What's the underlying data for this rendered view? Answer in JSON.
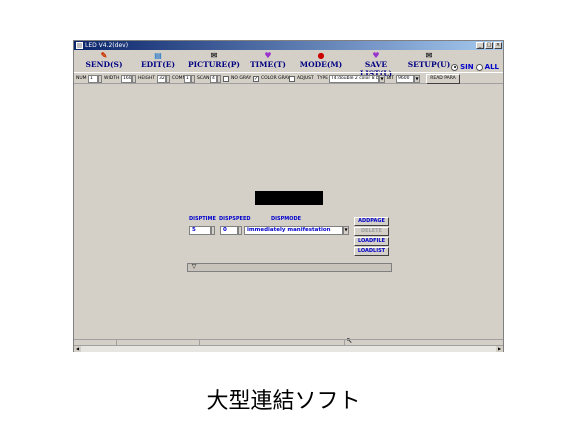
{
  "window": {
    "title": "LED V4.2(dev)",
    "controls": [
      "_",
      "□",
      "×"
    ]
  },
  "menu": [
    {
      "label": "SEND(S)",
      "icon": "send-icon",
      "glyph": "✎"
    },
    {
      "label": "EDIT(E)",
      "icon": "edit-icon",
      "glyph": "▤"
    },
    {
      "label": "PICTURE(P)",
      "icon": "picture-icon",
      "glyph": "✉"
    },
    {
      "label": "TIME(T)",
      "icon": "time-icon",
      "glyph": "♥"
    },
    {
      "label": "MODE(M)",
      "icon": "mode-icon",
      "glyph": "●"
    },
    {
      "label": "SAVE LIST(L)",
      "icon": "save-list-icon",
      "glyph": "♥"
    },
    {
      "label": "SETUP(U)",
      "icon": "setup-icon",
      "glyph": "✉"
    }
  ],
  "mode_radio": {
    "single": "SIN",
    "all": "ALL",
    "selected": "single"
  },
  "toolbar": {
    "num_label": "NUM",
    "num_value": "1",
    "width_label": "WIDTH",
    "width_value": "160",
    "height_label": "HEIGHT",
    "height_value": "32",
    "comm_label": "COMM",
    "comm_value": "1",
    "scan_label": "SCAN",
    "scan_value": "4",
    "no_gray_label": "NO GRAY",
    "no_gray_checked": false,
    "color_gray_label": "COLOR GRAY",
    "color_gray_checked": true,
    "adjust_label": "ADJUST",
    "adjust_checked": false,
    "type_label": "TYPE",
    "type_value": "T4:double 2 color 8 bit",
    "bit_label": "BIT",
    "bit_value": "9600",
    "read_para_label": "READ PARA"
  },
  "panel": {
    "disptime_label": "DISPTIME",
    "disptime_value": "5",
    "dispspeed_label": "DISPSPEED",
    "dispspeed_value": "0",
    "dispmode_label": "DISPMODE",
    "dispmode_value": "immediately manifestation",
    "buttons": {
      "addpage": "ADDPAGE",
      "delete": "DELETE",
      "loadfile": "LOADFILE",
      "loadlist": "LOADLIST"
    }
  },
  "caption": "大型連結ソフト"
}
